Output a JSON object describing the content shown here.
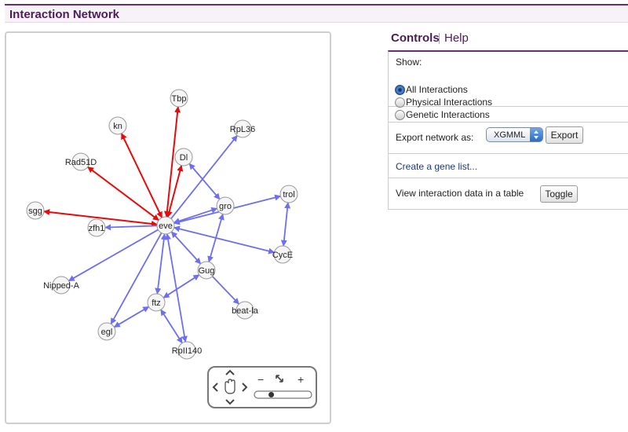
{
  "header": {
    "title": "Interaction Network"
  },
  "colors": {
    "genetic_edge": "#e8090a",
    "physical_edge": "#6e6ef0",
    "accent": "#6a2c70"
  },
  "network": {
    "nodes": [
      {
        "id": "Tbp",
        "label": "Tbp"
      },
      {
        "id": "kn",
        "label": "kn"
      },
      {
        "id": "RpL36",
        "label": "RpL36"
      },
      {
        "id": "Dl",
        "label": "Dl"
      },
      {
        "id": "trol",
        "label": "trol"
      },
      {
        "id": "Rad51D",
        "label": "Rad51D"
      },
      {
        "id": "gro",
        "label": "gro"
      },
      {
        "id": "sgg",
        "label": "sgg"
      },
      {
        "id": "eve",
        "label": "eve"
      },
      {
        "id": "zfh1",
        "label": "zfh1"
      },
      {
        "id": "CycE",
        "label": "CycE"
      },
      {
        "id": "Gug",
        "label": "Gug"
      },
      {
        "id": "Nipped-A",
        "label": "Nipped-A"
      },
      {
        "id": "ftz",
        "label": "ftz"
      },
      {
        "id": "beat-la",
        "label": "beat-la"
      },
      {
        "id": "egl",
        "label": "egl"
      },
      {
        "id": "RpII140",
        "label": "RpII140"
      }
    ],
    "edges": [
      {
        "from": "eve",
        "to": "Tbp",
        "type": "genetic",
        "arrows": "both"
      },
      {
        "from": "eve",
        "to": "kn",
        "type": "genetic",
        "arrows": "both"
      },
      {
        "from": "eve",
        "to": "Rad51D",
        "type": "genetic",
        "arrows": "both"
      },
      {
        "from": "eve",
        "to": "sgg",
        "type": "genetic",
        "arrows": "both"
      },
      {
        "from": "eve",
        "to": "Dl",
        "type": "genetic",
        "arrows": "both"
      },
      {
        "from": "eve",
        "to": "RpL36",
        "type": "physical",
        "arrows": "end"
      },
      {
        "from": "eve",
        "to": "zfh1",
        "type": "physical",
        "arrows": "end"
      },
      {
        "from": "eve",
        "to": "gro",
        "type": "physical",
        "arrows": "both"
      },
      {
        "from": "eve",
        "to": "trol",
        "type": "physical",
        "arrows": "both"
      },
      {
        "from": "eve",
        "to": "CycE",
        "type": "physical",
        "arrows": "both"
      },
      {
        "from": "eve",
        "to": "Gug",
        "type": "physical",
        "arrows": "both"
      },
      {
        "from": "eve",
        "to": "Nipped-A",
        "type": "physical",
        "arrows": "end"
      },
      {
        "from": "eve",
        "to": "ftz",
        "type": "physical",
        "arrows": "both"
      },
      {
        "from": "eve",
        "to": "egl",
        "type": "physical",
        "arrows": "end"
      },
      {
        "from": "eve",
        "to": "RpII140",
        "type": "physical",
        "arrows": "both"
      },
      {
        "from": "Dl",
        "to": "gro",
        "type": "physical",
        "arrows": "both"
      },
      {
        "from": "trol",
        "to": "CycE",
        "type": "physical",
        "arrows": "both"
      },
      {
        "from": "gro",
        "to": "Gug",
        "type": "physical",
        "arrows": "both"
      },
      {
        "from": "Gug",
        "to": "ftz",
        "type": "physical",
        "arrows": "both"
      },
      {
        "from": "Gug",
        "to": "beat-la",
        "type": "physical",
        "arrows": "end"
      },
      {
        "from": "ftz",
        "to": "egl",
        "type": "physical",
        "arrows": "both"
      },
      {
        "from": "ftz",
        "to": "RpII140",
        "type": "physical",
        "arrows": "both"
      }
    ]
  },
  "navigator": {
    "zoom_out": "−",
    "zoom_in": "+",
    "zoom_level": 0.27
  },
  "controls": {
    "tabs": {
      "controls": "Controls",
      "help": "Help"
    },
    "show": {
      "label": "Show:",
      "options": [
        {
          "label": "All Interactions",
          "selected": true
        },
        {
          "label": "Physical Interactions",
          "selected": false
        },
        {
          "label": "Genetic Interactions",
          "selected": false
        }
      ]
    },
    "export": {
      "label": "Export network as:",
      "format": "XGMML",
      "button": "Export"
    },
    "gene_list_link": "Create a gene list...",
    "table": {
      "label": "View interaction data in a table",
      "button": "Toggle"
    }
  }
}
